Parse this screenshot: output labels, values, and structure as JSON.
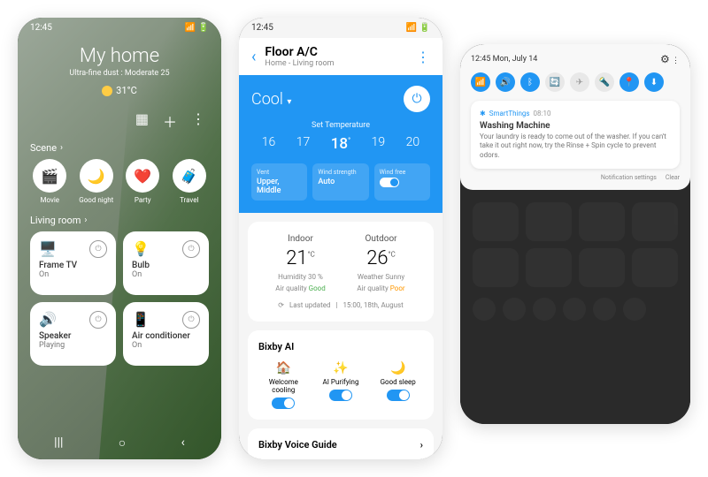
{
  "p1": {
    "time": "12:45",
    "title": "My home",
    "subtitle": "Ultra-fine dust : Moderate 25",
    "temp": "31°C",
    "scene_header": "Scene",
    "scenes": [
      {
        "icon": "🎬",
        "label": "Movie"
      },
      {
        "icon": "🌙",
        "label": "Good night"
      },
      {
        "icon": "❤️",
        "label": "Party"
      },
      {
        "icon": "🧳",
        "label": "Travel"
      }
    ],
    "room_header": "Living room",
    "devices": [
      {
        "icon": "🖥️",
        "name": "Frame TV",
        "status": "On"
      },
      {
        "icon": "💡",
        "name": "Bulb",
        "status": "On"
      },
      {
        "icon": "🔊",
        "name": "Speaker",
        "status": "Playing"
      },
      {
        "icon": "📱",
        "name": "Air conditioner",
        "status": "On"
      }
    ]
  },
  "p2": {
    "time": "12:45",
    "title": "Floor A/C",
    "subtitle": "Home - Living room",
    "mode": "Cool",
    "set_label": "Set Temperature",
    "temps": [
      "16",
      "17",
      "18",
      "19",
      "20"
    ],
    "active_temp": "18",
    "settings": [
      {
        "label": "Vent",
        "value": "Upper, Middle"
      },
      {
        "label": "Wind strength",
        "value": "Auto"
      },
      {
        "label": "Wind free",
        "value": ""
      }
    ],
    "indoor_label": "Indoor",
    "indoor_val": "21",
    "indoor_hum": "Humidity 30 %",
    "indoor_aq": "Air quality ",
    "indoor_aq_val": "Good",
    "outdoor_label": "Outdoor",
    "outdoor_val": "26",
    "outdoor_w": "Weather Sunny",
    "outdoor_aq": "Air quality ",
    "outdoor_aq_val": "Poor",
    "updated_label": "Last updated",
    "updated_val": "15:00, 18th, August",
    "bixby_title": "Bixby AI",
    "bixby": [
      {
        "icon": "🏠",
        "label": "Welcome cooling"
      },
      {
        "icon": "✨",
        "label": "AI Purifying"
      },
      {
        "icon": "🌙",
        "label": "Good sleep"
      }
    ],
    "voice_guide": "Bixby Voice Guide"
  },
  "p3": {
    "time": "12:45 Mon, July 14",
    "app": "SmartThings",
    "notif_time": "08:10",
    "notif_title": "Washing Machine",
    "notif_body": "Your laundry is ready to come out of the washer. If you can't take it out right now, try the Rinse + Spin cycle to prevent odors.",
    "settings_label": "Notification settings",
    "clear_label": "Clear"
  }
}
